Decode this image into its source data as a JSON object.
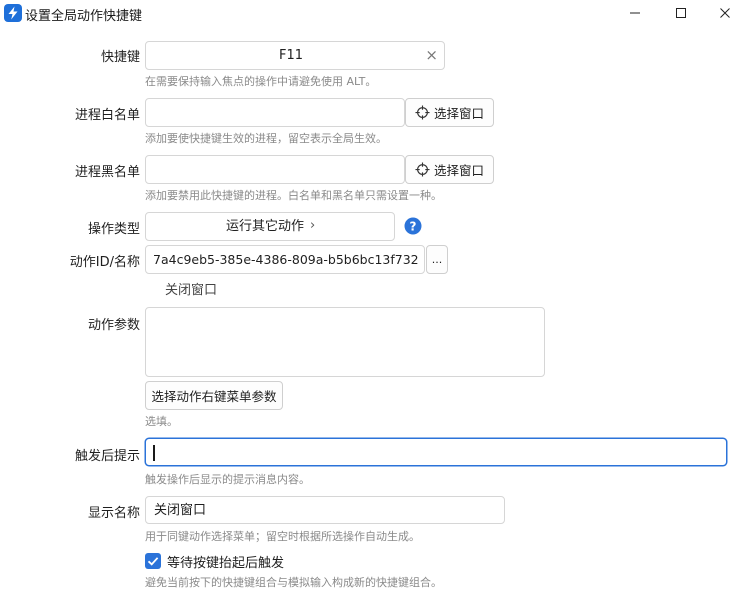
{
  "window": {
    "title": "设置全局动作快捷键"
  },
  "hotkey": {
    "label": "快捷键",
    "value": "F11",
    "clear": "×",
    "hint": "在需要保持输入焦点的操作中请避免使用 ALT。"
  },
  "whitelist": {
    "label": "进程白名单",
    "value": "",
    "button": "选择窗口",
    "hint": "添加要使快捷键生效的进程，留空表示全局生效。"
  },
  "blacklist": {
    "label": "进程黑名单",
    "value": "",
    "button": "选择窗口",
    "hint": "添加要禁用此快捷键的进程。白名单和黑名单只需设置一种。"
  },
  "action_type": {
    "label": "操作类型",
    "value": "运行其它动作",
    "chevron": "›"
  },
  "action_id": {
    "label": "动作ID/名称",
    "value": "7a4c9eb5-385e-4386-809a-b5b6bc13f732",
    "more": "...",
    "resolved_name": "关闭窗口"
  },
  "action_params": {
    "label": "动作参数",
    "value": "",
    "button": "选择动作右键菜单参数",
    "hint": "选填。"
  },
  "trigger_tip": {
    "label": "触发后提示",
    "value": "",
    "hint": "触发操作后显示的提示消息内容。"
  },
  "display_name": {
    "label": "显示名称",
    "value": "关闭窗口",
    "hint": "用于同键动作选择菜单；留空时根据所选操作自动生成。"
  },
  "wait_release": {
    "label": "等待按键抬起后触发",
    "checked": true,
    "hint": "避免当前按下的快捷键组合与模拟输入构成新的快捷键组合。"
  },
  "colors": {
    "accent": "#2b73d9",
    "hint": "#8a8a8a",
    "border": "#d6d6d6"
  }
}
